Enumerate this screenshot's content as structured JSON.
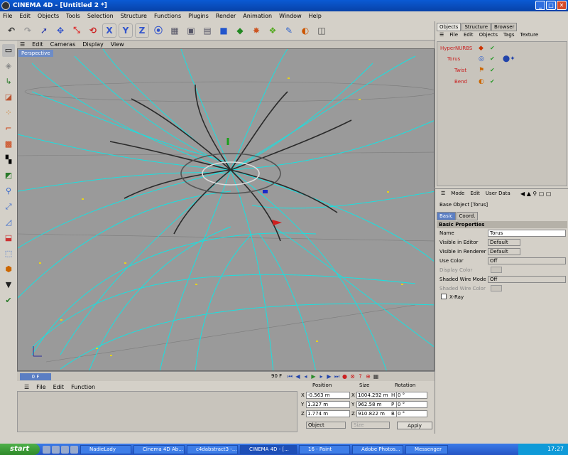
{
  "window": {
    "title": "CINEMA 4D - [Untitled 2 *]"
  },
  "menubar": [
    "File",
    "Edit",
    "Objects",
    "Tools",
    "Selection",
    "Structure",
    "Functions",
    "Plugins",
    "Render",
    "Animation",
    "Window",
    "Help"
  ],
  "toolbar": {
    "icons": [
      "undo-icon",
      "redo-icon",
      "pointer-icon",
      "move-icon",
      "scale-icon",
      "rotate-icon",
      "x-axis-icon",
      "y-axis-icon",
      "z-axis-icon",
      "world-icon",
      "render-view-icon",
      "render-picture-icon",
      "render-settings-icon",
      "cube-icon",
      "hypernurbs-icon",
      "sphere-icon",
      "floor-icon",
      "light-icon",
      "deformer-icon",
      "camera-icon"
    ]
  },
  "viewport": {
    "menu": [
      "Edit",
      "Cameras",
      "Display",
      "View"
    ],
    "label": "Perspective"
  },
  "timeline": {
    "current_frame": "0 F",
    "end_frame": "90 F"
  },
  "material_manager": {
    "menu": [
      "File",
      "Edit",
      "Function"
    ]
  },
  "coordinates": {
    "headers": {
      "position": "Position",
      "size": "Size",
      "rotation": "Rotation"
    },
    "rows": [
      {
        "axis": "X",
        "pos": "-0.563 m",
        "size_axis": "X",
        "size": "1004.292 m",
        "rot_axis": "H",
        "rot": "0 °"
      },
      {
        "axis": "Y",
        "pos": "1.327 m",
        "size_axis": "Y",
        "size": "962.58 m",
        "rot_axis": "P",
        "rot": "0 °"
      },
      {
        "axis": "Z",
        "pos": "1.774 m",
        "size_axis": "Z",
        "size": "910.822 m",
        "rot_axis": "B",
        "rot": "0 °"
      }
    ],
    "mode": "Object",
    "size_mode": "Size",
    "apply": "Apply"
  },
  "object_manager": {
    "tabs": [
      "Objects",
      "Structure",
      "Browser"
    ],
    "menu": [
      "File",
      "Edit",
      "Objects",
      "Tags",
      "Texture"
    ],
    "tree": [
      "HyperNURBS",
      "Torus",
      "Twist",
      "Bend"
    ]
  },
  "attribute_manager": {
    "menu": [
      "Mode",
      "Edit",
      "User Data"
    ],
    "object": "Base Object [Torus]",
    "tabs": [
      "Basic",
      "Coord."
    ],
    "section": "Basic Properties",
    "props": [
      {
        "label": "Name",
        "value": "Torus"
      },
      {
        "label": "Visible in Editor",
        "value": "Default"
      },
      {
        "label": "Visible in Renderer",
        "value": "Default"
      },
      {
        "label": "Use Color",
        "value": "Off"
      },
      {
        "label": "Display Color",
        "value": ""
      },
      {
        "label": "Shaded Wire Mode",
        "value": "Off"
      },
      {
        "label": "Shaded Wire Color",
        "value": ""
      },
      {
        "label": "X-Ray",
        "value": ""
      }
    ]
  },
  "taskbar": {
    "start": "start",
    "tasks": [
      "NadieLady",
      "Cinema 4D Ab...",
      "c4dabstract3 -...",
      "CINEMA 4D - [...",
      "16 - Paint",
      "Adobe Photos...",
      "Messenger"
    ],
    "clock": "17:27"
  },
  "colors": {
    "accent": "#5b7ec3",
    "curve": "#19e0e0",
    "title": "#0a5ad4"
  }
}
